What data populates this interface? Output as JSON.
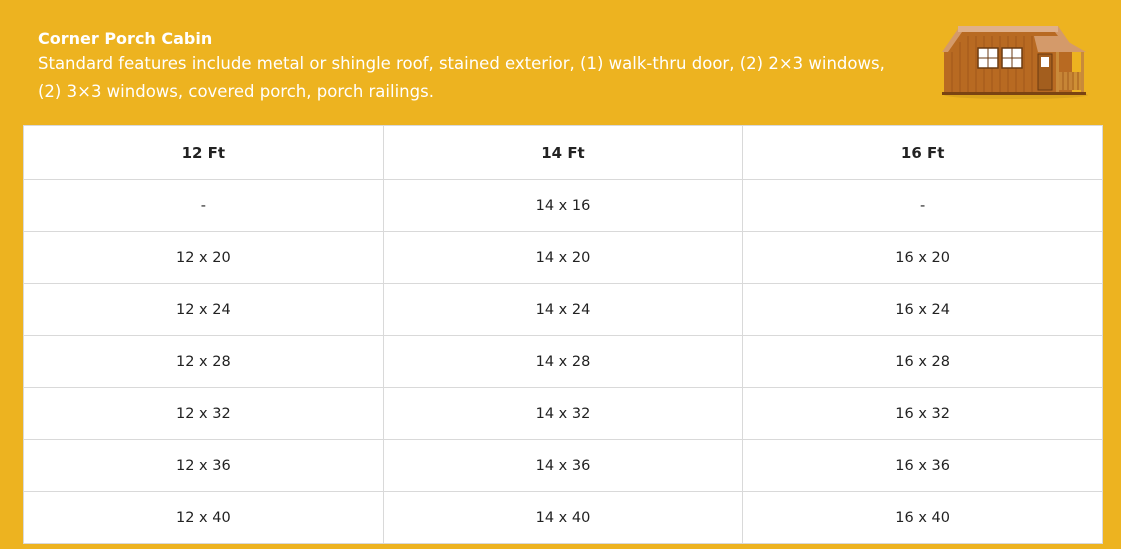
{
  "header": {
    "title": "Corner Porch Cabin",
    "description": "Standard features include metal or shingle roof, stained exterior, (1) walk-thru door, (2) 2×3 windows, (2) 3×3 windows, covered porch, porch railings."
  },
  "table": {
    "columns": [
      "12 Ft",
      "14 Ft",
      "16 Ft"
    ],
    "rows": [
      [
        "-",
        "14 x 16",
        "-"
      ],
      [
        "12 x 20",
        "14 x 20",
        "16 x 20"
      ],
      [
        "12 x 24",
        "14 x 24",
        "16 x 24"
      ],
      [
        "12 x 28",
        "14 x 28",
        "16 x 28"
      ],
      [
        "12 x 32",
        "14 x 32",
        "16 x 32"
      ],
      [
        "12 x 36",
        "14 x 36",
        "16 x 36"
      ],
      [
        "12 x 40",
        "14 x 40",
        "16 x 40"
      ]
    ]
  },
  "colors": {
    "background": "#EDB320",
    "table_border": "#d9d9d9",
    "text": "#222222"
  },
  "image": {
    "subject": "corner-porch-cabin-photo"
  }
}
